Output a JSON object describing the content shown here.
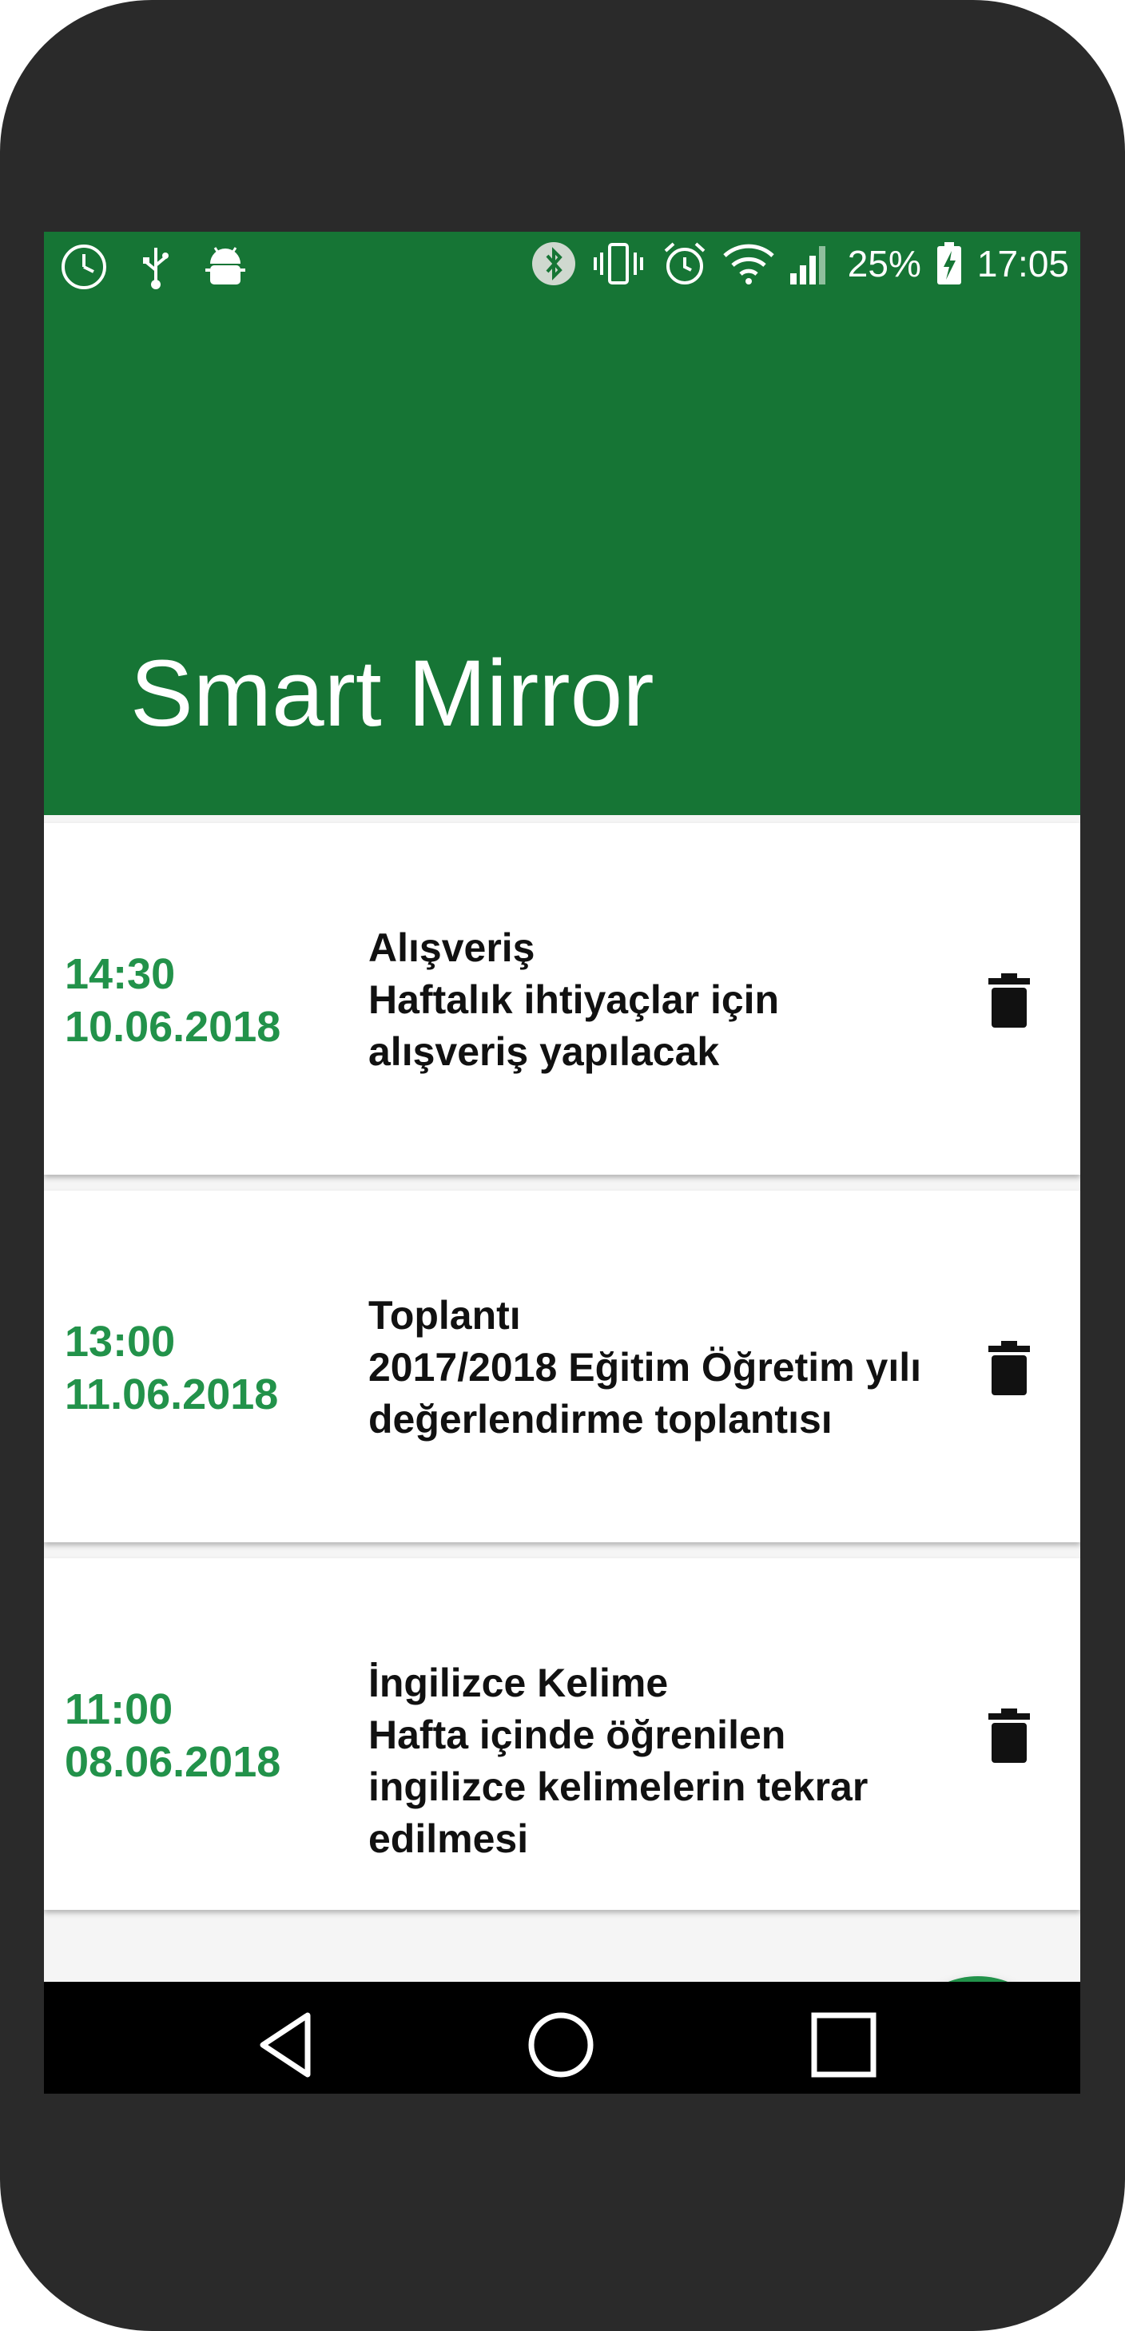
{
  "status_bar": {
    "battery": "25%",
    "time": "17:05",
    "left_icons": [
      "clock-widget-icon",
      "usb-icon",
      "android-debug-icon"
    ],
    "right_icons": [
      "bluetooth-icon",
      "vibrate-icon",
      "alarm-icon",
      "wifi-icon",
      "signal-icon",
      "battery-charging-icon"
    ]
  },
  "app_bar": {
    "title": "Smart Mirror"
  },
  "events": [
    {
      "time": "14:30",
      "date": "10.06.2018",
      "title": "Alışveriş",
      "description": "Haftalık ihtiyaçlar için alışveriş yapılacak"
    },
    {
      "time": "13:00",
      "date": "11.06.2018",
      "title": "Toplantı",
      "description": "2017/2018 Eğitim Öğretim yılı değerlendirme toplantısı"
    },
    {
      "time": "11:00",
      "date": "08.06.2018",
      "title": "İngilizce Kelime",
      "description": "Hafta içinde öğrenilen ingilizce kelimelerin tekrar edilmesi"
    }
  ],
  "colors": {
    "primary": "#167535",
    "accent": "#22924a",
    "text": "#111111",
    "device": "#2a2a2a"
  },
  "nav_icons": [
    "back-icon",
    "home-icon",
    "recents-icon"
  ],
  "fab_icon": "plus-icon"
}
